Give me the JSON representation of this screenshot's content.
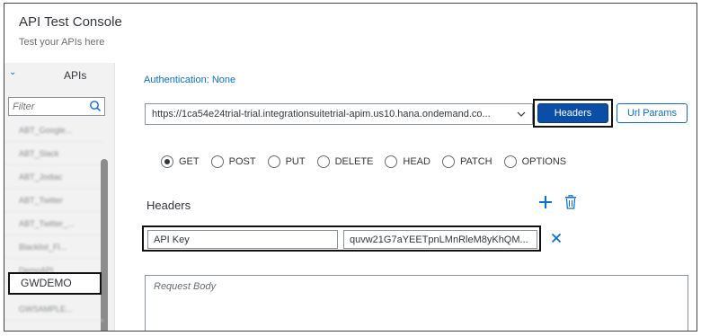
{
  "app": {
    "title": "API Test Console",
    "subtitle": "Test your APIs here"
  },
  "sidebar": {
    "header_label": "APIs",
    "filter_placeholder": "Filter",
    "items": [
      {
        "label": "ABT_Google..."
      },
      {
        "label": "ABT_Slack"
      },
      {
        "label": "ABT_Jodiac"
      },
      {
        "label": "ABT_Twitter"
      },
      {
        "label": "ABT_Twitter_..."
      },
      {
        "label": "Blacklist_Fl..."
      },
      {
        "label": "DemoAPI"
      },
      {
        "label": "GWDEMO",
        "selected": true
      },
      {
        "label": "GWSAMPLE..."
      }
    ]
  },
  "main": {
    "authentication": "Authentication: None",
    "url": "https://1ca54e24trial-trial.integrationsuitetrial-apim.us10.hana.ondemand.co...",
    "headers_button": "Headers",
    "url_params_button": "Url Params",
    "methods": [
      {
        "label": "GET",
        "selected": true
      },
      {
        "label": "POST",
        "selected": false
      },
      {
        "label": "PUT",
        "selected": false
      },
      {
        "label": "DELETE",
        "selected": false
      },
      {
        "label": "HEAD",
        "selected": false
      },
      {
        "label": "PATCH",
        "selected": false
      },
      {
        "label": "OPTIONS",
        "selected": false
      }
    ],
    "headers_title": "Headers",
    "header_rows": [
      {
        "key": "API Key",
        "value": "quvw21G7aYEETpnLMnRleM8yKhQM..."
      }
    ],
    "request_body_placeholder": "Request Body"
  },
  "colors": {
    "accent": "#0a6ed1",
    "primary_button": "#0a4ea8",
    "sidebar_bg": "#f2f2f2"
  },
  "icons": {
    "search": "search-icon",
    "dropdown": "chevron-down-icon",
    "collapse": "chevron-down-icon",
    "add": "add-icon",
    "delete": "trash-icon",
    "remove": "close-icon"
  }
}
